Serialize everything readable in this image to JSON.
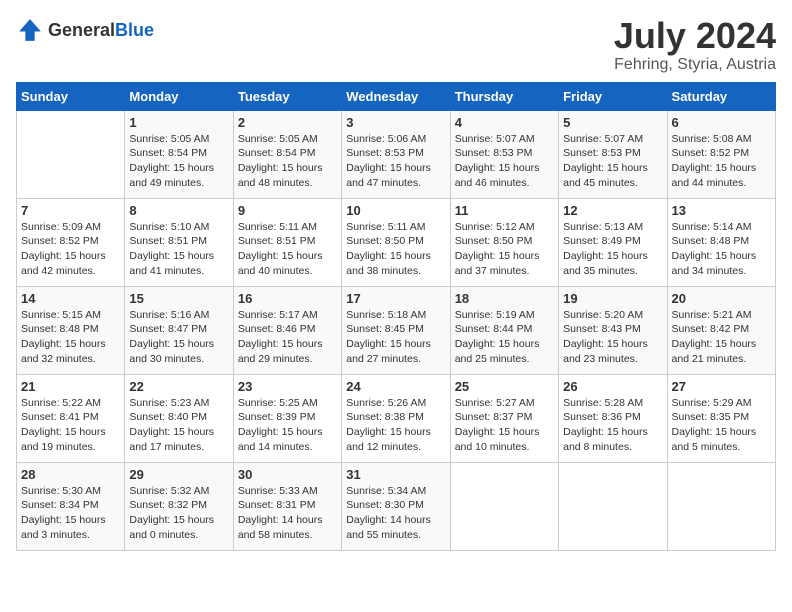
{
  "header": {
    "logo_general": "General",
    "logo_blue": "Blue",
    "title": "July 2024",
    "subtitle": "Fehring, Styria, Austria"
  },
  "weekdays": [
    "Sunday",
    "Monday",
    "Tuesday",
    "Wednesday",
    "Thursday",
    "Friday",
    "Saturday"
  ],
  "weeks": [
    [
      {
        "day": "",
        "info": ""
      },
      {
        "day": "1",
        "info": "Sunrise: 5:05 AM\nSunset: 8:54 PM\nDaylight: 15 hours\nand 49 minutes."
      },
      {
        "day": "2",
        "info": "Sunrise: 5:05 AM\nSunset: 8:54 PM\nDaylight: 15 hours\nand 48 minutes."
      },
      {
        "day": "3",
        "info": "Sunrise: 5:06 AM\nSunset: 8:53 PM\nDaylight: 15 hours\nand 47 minutes."
      },
      {
        "day": "4",
        "info": "Sunrise: 5:07 AM\nSunset: 8:53 PM\nDaylight: 15 hours\nand 46 minutes."
      },
      {
        "day": "5",
        "info": "Sunrise: 5:07 AM\nSunset: 8:53 PM\nDaylight: 15 hours\nand 45 minutes."
      },
      {
        "day": "6",
        "info": "Sunrise: 5:08 AM\nSunset: 8:52 PM\nDaylight: 15 hours\nand 44 minutes."
      }
    ],
    [
      {
        "day": "7",
        "info": "Sunrise: 5:09 AM\nSunset: 8:52 PM\nDaylight: 15 hours\nand 42 minutes."
      },
      {
        "day": "8",
        "info": "Sunrise: 5:10 AM\nSunset: 8:51 PM\nDaylight: 15 hours\nand 41 minutes."
      },
      {
        "day": "9",
        "info": "Sunrise: 5:11 AM\nSunset: 8:51 PM\nDaylight: 15 hours\nand 40 minutes."
      },
      {
        "day": "10",
        "info": "Sunrise: 5:11 AM\nSunset: 8:50 PM\nDaylight: 15 hours\nand 38 minutes."
      },
      {
        "day": "11",
        "info": "Sunrise: 5:12 AM\nSunset: 8:50 PM\nDaylight: 15 hours\nand 37 minutes."
      },
      {
        "day": "12",
        "info": "Sunrise: 5:13 AM\nSunset: 8:49 PM\nDaylight: 15 hours\nand 35 minutes."
      },
      {
        "day": "13",
        "info": "Sunrise: 5:14 AM\nSunset: 8:48 PM\nDaylight: 15 hours\nand 34 minutes."
      }
    ],
    [
      {
        "day": "14",
        "info": "Sunrise: 5:15 AM\nSunset: 8:48 PM\nDaylight: 15 hours\nand 32 minutes."
      },
      {
        "day": "15",
        "info": "Sunrise: 5:16 AM\nSunset: 8:47 PM\nDaylight: 15 hours\nand 30 minutes."
      },
      {
        "day": "16",
        "info": "Sunrise: 5:17 AM\nSunset: 8:46 PM\nDaylight: 15 hours\nand 29 minutes."
      },
      {
        "day": "17",
        "info": "Sunrise: 5:18 AM\nSunset: 8:45 PM\nDaylight: 15 hours\nand 27 minutes."
      },
      {
        "day": "18",
        "info": "Sunrise: 5:19 AM\nSunset: 8:44 PM\nDaylight: 15 hours\nand 25 minutes."
      },
      {
        "day": "19",
        "info": "Sunrise: 5:20 AM\nSunset: 8:43 PM\nDaylight: 15 hours\nand 23 minutes."
      },
      {
        "day": "20",
        "info": "Sunrise: 5:21 AM\nSunset: 8:42 PM\nDaylight: 15 hours\nand 21 minutes."
      }
    ],
    [
      {
        "day": "21",
        "info": "Sunrise: 5:22 AM\nSunset: 8:41 PM\nDaylight: 15 hours\nand 19 minutes."
      },
      {
        "day": "22",
        "info": "Sunrise: 5:23 AM\nSunset: 8:40 PM\nDaylight: 15 hours\nand 17 minutes."
      },
      {
        "day": "23",
        "info": "Sunrise: 5:25 AM\nSunset: 8:39 PM\nDaylight: 15 hours\nand 14 minutes."
      },
      {
        "day": "24",
        "info": "Sunrise: 5:26 AM\nSunset: 8:38 PM\nDaylight: 15 hours\nand 12 minutes."
      },
      {
        "day": "25",
        "info": "Sunrise: 5:27 AM\nSunset: 8:37 PM\nDaylight: 15 hours\nand 10 minutes."
      },
      {
        "day": "26",
        "info": "Sunrise: 5:28 AM\nSunset: 8:36 PM\nDaylight: 15 hours\nand 8 minutes."
      },
      {
        "day": "27",
        "info": "Sunrise: 5:29 AM\nSunset: 8:35 PM\nDaylight: 15 hours\nand 5 minutes."
      }
    ],
    [
      {
        "day": "28",
        "info": "Sunrise: 5:30 AM\nSunset: 8:34 PM\nDaylight: 15 hours\nand 3 minutes."
      },
      {
        "day": "29",
        "info": "Sunrise: 5:32 AM\nSunset: 8:32 PM\nDaylight: 15 hours\nand 0 minutes."
      },
      {
        "day": "30",
        "info": "Sunrise: 5:33 AM\nSunset: 8:31 PM\nDaylight: 14 hours\nand 58 minutes."
      },
      {
        "day": "31",
        "info": "Sunrise: 5:34 AM\nSunset: 8:30 PM\nDaylight: 14 hours\nand 55 minutes."
      },
      {
        "day": "",
        "info": ""
      },
      {
        "day": "",
        "info": ""
      },
      {
        "day": "",
        "info": ""
      }
    ]
  ]
}
